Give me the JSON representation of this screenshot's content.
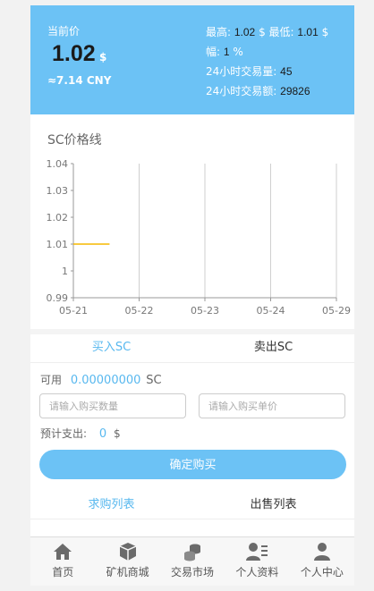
{
  "header": {
    "current_label": "当前价",
    "price": "1.02",
    "price_unit": "$",
    "cny": "≈7.14 CNY",
    "high_label": "最高:",
    "high_value": "1.02",
    "high_unit": "$",
    "low_label": "最低:",
    "low_value": "1.01",
    "low_unit": "$",
    "range_label": "幅:",
    "range_value": "1",
    "range_unit": "%",
    "volume_label": "24小时交易量:",
    "volume_value": "45",
    "amount_label": "24小时交易额:",
    "amount_value": "29826"
  },
  "chart_data": {
    "type": "line",
    "title": "SC价格线",
    "xlabel": "",
    "ylabel": "",
    "categories": [
      "05-21",
      "05-22",
      "05-23",
      "05-24",
      "05-29"
    ],
    "y_ticks": [
      "1.04",
      "1.03",
      "1.02",
      "1.01",
      "1",
      "0.99"
    ],
    "ylim": [
      0.99,
      1.04
    ],
    "grid": "vertical",
    "series": [
      {
        "color": "#f5b800",
        "points": [
          [
            0,
            1.01
          ],
          [
            0.55,
            1.01
          ]
        ]
      }
    ]
  },
  "tabs": {
    "buy": "买入SC",
    "sell": "卖出SC"
  },
  "trade": {
    "available_label": "可用",
    "available_value": "0.00000000",
    "available_unit": "SC",
    "qty_placeholder": "请输入购买数量",
    "price_placeholder": "请输入购买单价",
    "estimate_label": "预计支出:",
    "estimate_value": "0",
    "estimate_unit": "$",
    "confirm_label": "确定购买"
  },
  "lists": {
    "buy_list": "求购列表",
    "sell_list": "出售列表"
  },
  "footer": {
    "items": [
      {
        "label": "首页",
        "icon": "home-icon"
      },
      {
        "label": "矿机商城",
        "icon": "box-icon"
      },
      {
        "label": "交易市场",
        "icon": "coins-icon"
      },
      {
        "label": "个人资料",
        "icon": "profile-icon"
      },
      {
        "label": "个人中心",
        "icon": "user-icon"
      }
    ]
  },
  "colors": {
    "accent": "#6cc2f5",
    "link": "#58b8ef",
    "line": "#f5b800"
  }
}
